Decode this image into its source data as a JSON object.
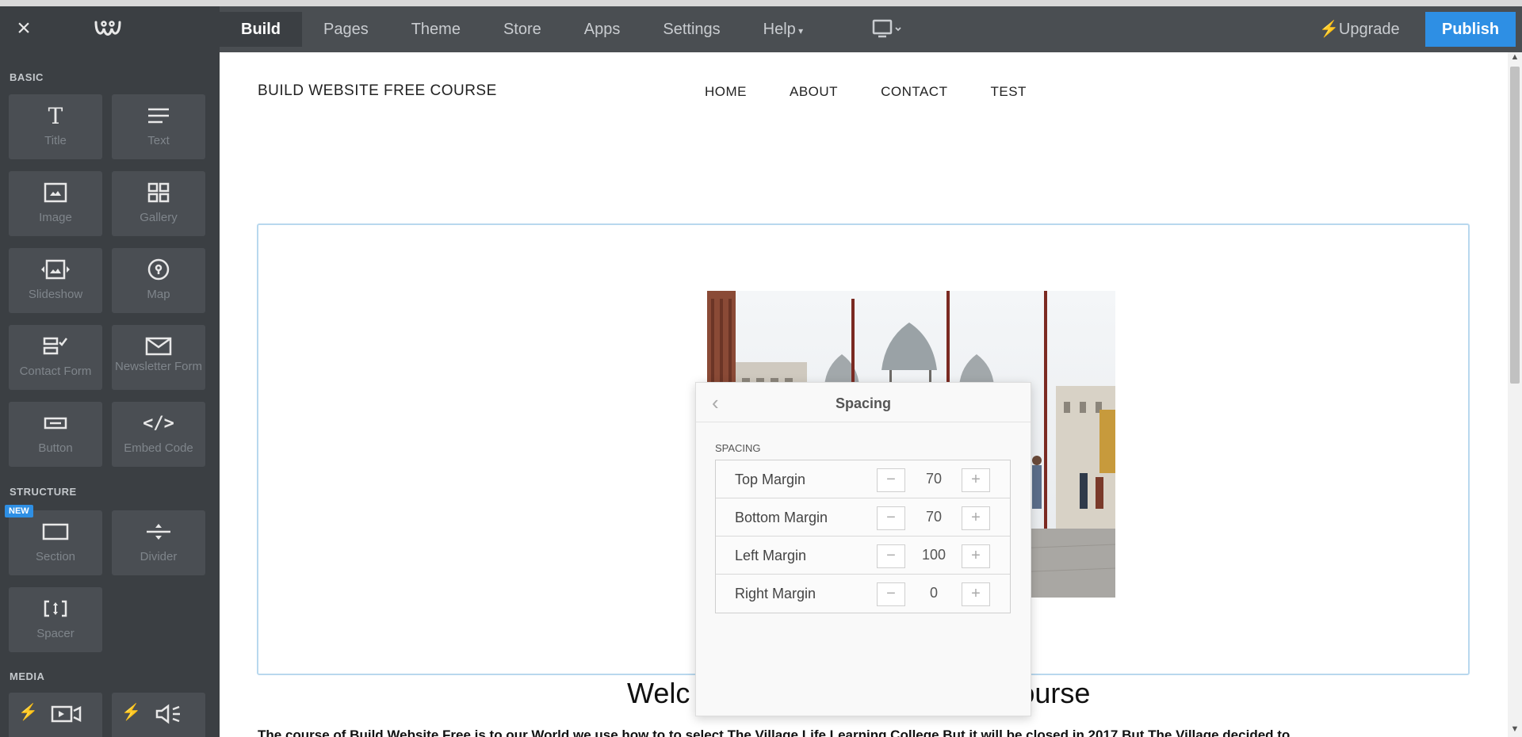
{
  "topbar": {
    "nav": [
      "Build",
      "Pages",
      "Theme",
      "Store",
      "Apps",
      "Settings",
      "Help"
    ],
    "upgrade_label": "Upgrade",
    "publish_label": "Publish"
  },
  "sidebar": {
    "sections": {
      "basic": "BASIC",
      "structure": "STRUCTURE",
      "media": "MEDIA"
    },
    "items": {
      "title": "Title",
      "text": "Text",
      "image": "Image",
      "gallery": "Gallery",
      "slideshow": "Slideshow",
      "map": "Map",
      "contact_form": "Contact Form",
      "newsletter_form": "Newsletter Form",
      "button": "Button",
      "embed_code": "Embed Code",
      "section": "Section",
      "divider": "Divider",
      "spacer": "Spacer"
    },
    "new_badge": "NEW"
  },
  "site": {
    "title": "BUILD WEBSITE FREE COURSE",
    "nav": [
      "HOME",
      "ABOUT",
      "CONTACT",
      "TEST"
    ],
    "welcome_left": "Welc",
    "welcome_right": "ourse",
    "paragraph": "The course of Build Website Free is to our World we use how to to select The Village Life Learning College But it will be closed in 2017 But The Village decided to"
  },
  "popover": {
    "title": "Spacing",
    "subtitle": "SPACING",
    "rows": [
      {
        "label": "Top Margin",
        "value": "70"
      },
      {
        "label": "Bottom Margin",
        "value": "70"
      },
      {
        "label": "Left Margin",
        "value": "100"
      },
      {
        "label": "Right Margin",
        "value": "0"
      }
    ],
    "minus": "−",
    "plus": "+"
  },
  "colors": {
    "topbar": "#4a4e52",
    "sidebar": "#3b3f43",
    "tile": "#4a4e53",
    "accent": "#2e8fe4",
    "bolt": "#f5a623"
  }
}
